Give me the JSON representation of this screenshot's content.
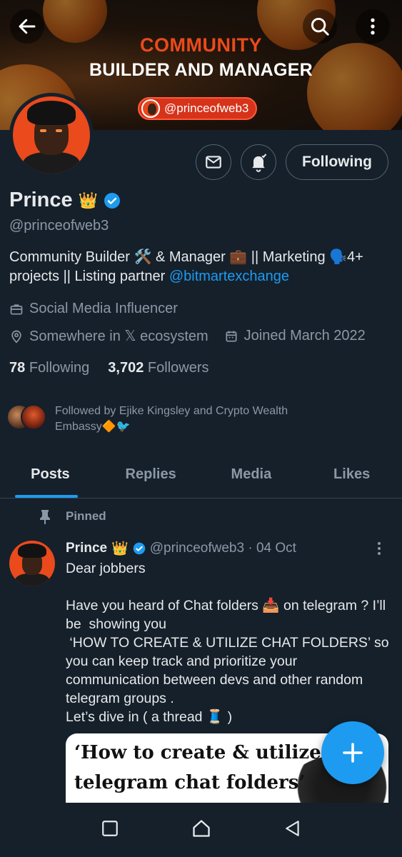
{
  "banner": {
    "line1": "COMMUNITY",
    "line2": "BUILDER AND MANAGER",
    "handle": "@princeofweb3"
  },
  "profile": {
    "name": "Prince",
    "name_emoji": "👑",
    "handle": "@princeofweb3",
    "bio_text": "Community Builder 🛠️ & Manager 💼 || Marketing 🗣️4+ projects || Listing partner ",
    "bio_link": "@bitmartexchange",
    "category": "Social Media Influencer",
    "location": "Somewhere in 𝕏 ecosystem",
    "joined": "Joined March 2022",
    "following_count": "78",
    "following_label": "Following",
    "followers_count": "3,702",
    "followers_label": "Followers",
    "followed_by": "Followed by Ejike Kingsley and Crypto Wealth Embassy🔶🐦"
  },
  "actions": {
    "follow_label": "Following",
    "message_icon": "mail-icon",
    "notify_icon": "bell-icon"
  },
  "tabs": [
    {
      "label": "Posts",
      "active": true
    },
    {
      "label": "Replies",
      "active": false
    },
    {
      "label": "Media",
      "active": false
    },
    {
      "label": "Likes",
      "active": false
    }
  ],
  "pinned_post": {
    "pinned_label": "Pinned",
    "author": "Prince",
    "author_emoji": "👑",
    "handle_date": "@princeofweb3 · 04 Oct",
    "text": "Dear jobbers\n\nHave you heard of Chat folders 📥 on telegram ? I’ll be  showing you\n ‘HOW TO CREATE & UTILIZE CHAT FOLDERS’ so you can keep track and prioritize your communication between devs and other random telegram groups .\nLet’s dive in ( a thread 🧵 )",
    "media_line1": "‘How to create & utilize",
    "media_line2": "telegram chat folders’"
  },
  "colors": {
    "background": "#15202b",
    "accent": "#1d9bf0",
    "muted": "#8b98a5",
    "banner_orange": "#ea4a1c"
  }
}
